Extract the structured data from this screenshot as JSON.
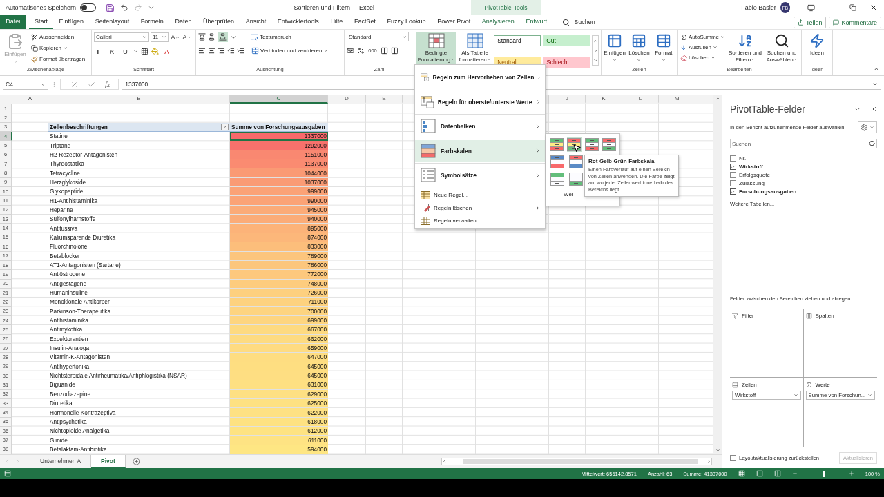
{
  "title_bar": {
    "autosave": {
      "label": "Automatisches Speichern",
      "on": false
    },
    "title": "Sortieren und Filtern  -  Excel",
    "context_tab": "PivotTable-Tools",
    "user": "Fabio Basler",
    "initials": "FB"
  },
  "tabs": [
    {
      "label": "Datei",
      "kind": "file",
      "selected": false
    },
    {
      "label": "Start",
      "kind": "normal",
      "selected": true
    },
    {
      "label": "Einfügen",
      "kind": "normal",
      "selected": false
    },
    {
      "label": "Seitenlayout",
      "kind": "normal",
      "selected": false
    },
    {
      "label": "Formeln",
      "kind": "normal",
      "selected": false
    },
    {
      "label": "Daten",
      "kind": "normal",
      "selected": false
    },
    {
      "label": "Überprüfen",
      "kind": "normal",
      "selected": false
    },
    {
      "label": "Ansicht",
      "kind": "normal",
      "selected": false
    },
    {
      "label": "Entwicklertools",
      "kind": "normal",
      "selected": false
    },
    {
      "label": "Hilfe",
      "kind": "normal",
      "selected": false
    },
    {
      "label": "FactSet",
      "kind": "normal",
      "selected": false
    },
    {
      "label": "Fuzzy Lookup",
      "kind": "normal",
      "selected": false
    },
    {
      "label": "Power Pivot",
      "kind": "normal",
      "selected": false
    },
    {
      "label": "Analysieren",
      "kind": "context",
      "selected": false
    },
    {
      "label": "Entwurf",
      "kind": "context",
      "selected": false
    }
  ],
  "tell_me": "Suchen",
  "share": "Teilen",
  "comments": "Kommentare",
  "clipboard": {
    "label": "Zwischenablage",
    "paste": "Einfügen",
    "cut": "Ausschneiden",
    "copy": "Kopieren",
    "format_painter": "Format übertragen"
  },
  "font": {
    "label": "Schriftart",
    "name": "Calibri",
    "size": "11",
    "grow": "A",
    "shrink": "A",
    "bold": "F",
    "italic": "K",
    "underline": "U",
    "color_letter": "A"
  },
  "alignment": {
    "label": "Ausrichtung",
    "wrap": "Textumbruch",
    "merge": "Verbinden und zentrieren"
  },
  "number": {
    "label": "Zahl",
    "format": "Standard",
    "thousands": "000"
  },
  "styles": {
    "conditional": {
      "label": "Bedingte Formatierung",
      "pressed": true
    },
    "as_table": "Als Tabelle formatieren",
    "gallery": [
      {
        "label": "Standard",
        "kind": "normal"
      },
      {
        "label": "Gut",
        "kind": "good"
      },
      {
        "label": "Neutral",
        "kind": "neutral"
      },
      {
        "label": "Schlecht",
        "kind": "bad"
      }
    ]
  },
  "cells": {
    "label": "Zellen",
    "buttons": [
      {
        "label": "Einfügen",
        "kind": "insert"
      },
      {
        "label": "Löschen",
        "kind": "delete"
      },
      {
        "label": "Format",
        "kind": "format"
      }
    ]
  },
  "editing": {
    "label": "Bearbeiten",
    "autosum": "AutoSumme",
    "fill": "Ausfüllen",
    "clear": "Löschen",
    "sort": "Sortieren und Filtern",
    "find": "Suchen und Auswählen"
  },
  "ideas": {
    "label": "Ideen",
    "button": "Ideen"
  },
  "formula_bar": {
    "name_box": "C4",
    "fx": "fx",
    "value": "1337000"
  },
  "columns_left": [
    {
      "label": "A",
      "selected": false
    },
    {
      "label": "B",
      "selected": false
    },
    {
      "label": "C",
      "selected": true
    },
    {
      "label": "D",
      "selected": false
    },
    {
      "label": "E",
      "selected": false
    }
  ],
  "columns_right": [
    {
      "label": "J",
      "selected": false
    },
    {
      "label": "K",
      "selected": false
    },
    {
      "label": "L",
      "selected": false
    },
    {
      "label": "M",
      "selected": false
    }
  ],
  "rows": [
    {
      "number": "1",
      "kind": "blank",
      "active": false
    },
    {
      "number": "2",
      "kind": "blank",
      "active": false
    },
    {
      "number": "3",
      "kind": "header",
      "label": "Zellenbeschriftungen",
      "value": "Summe von Forschungsausgaben",
      "active": false
    },
    {
      "number": "4",
      "kind": "data",
      "label": "Statine",
      "value": "1337000",
      "color": "#f8696b",
      "active": true
    },
    {
      "number": "5",
      "kind": "data",
      "label": "Triptane",
      "value": "1292000",
      "color": "#f8716c",
      "active": false
    },
    {
      "number": "6",
      "kind": "data",
      "label": "H2-Rezeptor-Antagonisten",
      "value": "1151000",
      "color": "#f98871",
      "active": false
    },
    {
      "number": "7",
      "kind": "data",
      "label": "Thyreostatika",
      "value": "1137000",
      "color": "#fa8b71",
      "active": false
    },
    {
      "number": "8",
      "kind": "data",
      "label": "Tetracycline",
      "value": "1044000",
      "color": "#fa9a74",
      "active": false
    },
    {
      "number": "9",
      "kind": "data",
      "label": "Herzglykoside",
      "value": "1037000",
      "color": "#fa9b75",
      "active": false
    },
    {
      "number": "10",
      "kind": "data",
      "label": "Glykopeptide",
      "value": "999000",
      "color": "#fba276",
      "active": false
    },
    {
      "number": "11",
      "kind": "data",
      "label": "H1-Antihistaminika",
      "value": "990000",
      "color": "#fba376",
      "active": false
    },
    {
      "number": "12",
      "kind": "data",
      "label": "Heparine",
      "value": "945000",
      "color": "#fbab78",
      "active": false
    },
    {
      "number": "13",
      "kind": "data",
      "label": "Sulfonylharnstoffe",
      "value": "940000",
      "color": "#fbac78",
      "active": false
    },
    {
      "number": "14",
      "kind": "data",
      "label": "Antitussiva",
      "value": "895000",
      "color": "#fcb379",
      "active": false
    },
    {
      "number": "15",
      "kind": "data",
      "label": "Kaliumsparende Diuretika",
      "value": "874000",
      "color": "#fcb77a",
      "active": false
    },
    {
      "number": "16",
      "kind": "data",
      "label": "Fluorchinolone",
      "value": "833000",
      "color": "#fcbe7b",
      "active": false
    },
    {
      "number": "17",
      "kind": "data",
      "label": "Betablocker",
      "value": "789000",
      "color": "#fcc57d",
      "active": false
    },
    {
      "number": "18",
      "kind": "data",
      "label": "AT1-Antagonisten (Sartane)",
      "value": "786000",
      "color": "#fcc67d",
      "active": false
    },
    {
      "number": "19",
      "kind": "data",
      "label": "Antiöstrogene",
      "value": "772000",
      "color": "#fdc87d",
      "active": false
    },
    {
      "number": "20",
      "kind": "data",
      "label": "Antigestagene",
      "value": "748000",
      "color": "#fdcc7e",
      "active": false
    },
    {
      "number": "21",
      "kind": "data",
      "label": "Humaninsuline",
      "value": "726000",
      "color": "#fdd07f",
      "active": false
    },
    {
      "number": "22",
      "kind": "data",
      "label": "Monoklonale Antikörper",
      "value": "711000",
      "color": "#fdd27f",
      "active": false
    },
    {
      "number": "23",
      "kind": "data",
      "label": "Parkinson-Therapeutika",
      "value": "700000",
      "color": "#fdd480",
      "active": false
    },
    {
      "number": "24",
      "kind": "data",
      "label": "Antihistaminika",
      "value": "699000",
      "color": "#fdd580",
      "active": false
    },
    {
      "number": "25",
      "kind": "data",
      "label": "Antimykotika",
      "value": "667000",
      "color": "#fdda81",
      "active": false
    },
    {
      "number": "26",
      "kind": "data",
      "label": "Expektorantien",
      "value": "662000",
      "color": "#fddb81",
      "active": false
    },
    {
      "number": "27",
      "kind": "data",
      "label": "Insulin-Analoga",
      "value": "659000",
      "color": "#fedb81",
      "active": false
    },
    {
      "number": "28",
      "kind": "data",
      "label": "Vitamin-K-Antagonisten",
      "value": "647000",
      "color": "#fedd81",
      "active": false
    },
    {
      "number": "29",
      "kind": "data",
      "label": "Antihypertonika",
      "value": "645000",
      "color": "#fede81",
      "active": false
    },
    {
      "number": "30",
      "kind": "data",
      "label": "Nichtsteroidale Antirheumatika/Antiphlogistika (NSAR)",
      "value": "645000",
      "color": "#fede82",
      "active": false
    },
    {
      "number": "31",
      "kind": "data",
      "label": "Biguanide",
      "value": "631000",
      "color": "#fee082",
      "active": false
    },
    {
      "number": "32",
      "kind": "data",
      "label": "Benzodiazepine",
      "value": "629000",
      "color": "#fee083",
      "active": false
    },
    {
      "number": "33",
      "kind": "data",
      "label": "Diuretika",
      "value": "625000",
      "color": "#fee182",
      "active": false
    },
    {
      "number": "34",
      "kind": "data",
      "label": "Hormonelle Kontrazeptiva",
      "value": "622000",
      "color": "#fee183",
      "active": false
    },
    {
      "number": "35",
      "kind": "data",
      "label": "Antipsychotika",
      "value": "618000",
      "color": "#fee282",
      "active": false
    },
    {
      "number": "36",
      "kind": "data",
      "label": "Nichtopioide Analgetika",
      "value": "612000",
      "color": "#fee382",
      "active": false
    },
    {
      "number": "37",
      "kind": "data",
      "label": "Glinide",
      "value": "611000",
      "color": "#fee383",
      "active": false
    },
    {
      "number": "38",
      "kind": "data",
      "label": "Betalaktam-Antibiotika",
      "value": "594000",
      "color": "#fee683",
      "active": false
    }
  ],
  "sheet_tabs": [
    {
      "label": "Unternehmen A",
      "selected": false
    },
    {
      "label": "Pivot",
      "selected": true
    }
  ],
  "pivot_panel": {
    "title": "PivotTable-Felder",
    "choose_label": "In den Bericht aufzunehmende Felder auswählen:",
    "search": {
      "placeholder": "Suchen"
    },
    "fields": [
      {
        "label": "Nr.",
        "checked": false
      },
      {
        "label": "Wirkstoff",
        "checked": true
      },
      {
        "label": "Erfolgsquote",
        "checked": false
      },
      {
        "label": "Zulassung",
        "checked": false
      },
      {
        "label": "Forschungsausgaben",
        "checked": true
      }
    ],
    "more_tables": "Weitere Tabellen...",
    "drag_label": "Felder zwischen den Bereichen ziehen und ablegen:",
    "areas": [
      {
        "kind": "filter",
        "label": "Filter"
      },
      {
        "kind": "columns",
        "label": "Spalten"
      },
      {
        "kind": "rows",
        "label": "Zeilen",
        "items": [
          "Wirkstoff"
        ]
      },
      {
        "kind": "values",
        "label": "Werte",
        "items": [
          "Summe von Forschun..."
        ]
      }
    ],
    "defer": {
      "label": "Layoutaktualisierung zurückstellen",
      "checked": false
    },
    "update": {
      "label": "Aktualisieren",
      "disabled": true
    }
  },
  "status_bar": {
    "average": "Mittelwert: 656142,8571",
    "count": "Anzahl: 63",
    "sum": "Summe: 41337000",
    "zoom_slider": {
      "level": 0.5
    },
    "zoom": "100 %"
  },
  "menu": {
    "items": [
      {
        "label": "Regeln zum Hervorheben von Zellen",
        "kind": "highlight",
        "submenu": true,
        "selected": false
      },
      {
        "label": "Regeln für oberste/unterste Werte",
        "kind": "topbottom",
        "submenu": true,
        "selected": false
      },
      {
        "label": "Datenbalken",
        "kind": "databar",
        "submenu": true,
        "selected": false
      },
      {
        "label": "Farbskalen",
        "kind": "colorscale",
        "submenu": true,
        "selected": true
      },
      {
        "label": "Symbolsätze",
        "kind": "iconset",
        "submenu": true,
        "selected": false
      },
      {
        "label": "Neue Regel...",
        "kind": "new",
        "submenu": false,
        "selected": false
      },
      {
        "label": "Regeln löschen",
        "kind": "clear",
        "submenu": true,
        "selected": false
      },
      {
        "label": "Regeln verwalten...",
        "kind": "manage",
        "submenu": false,
        "selected": false
      }
    ]
  },
  "color_scales": {
    "rows": [
      [
        {
          "selected": false
        },
        {
          "selected": true
        },
        {
          "selected": false
        },
        {
          "selected": false
        }
      ],
      [
        {
          "selected": false
        },
        {
          "selected": false
        }
      ],
      [
        {
          "selected": false
        },
        {
          "selected": false
        }
      ]
    ],
    "more": "Wei"
  },
  "tooltip": {
    "title": "Rot-Gelb-Grün-Farbskala",
    "text": "Einen Farbverlauf auf einen Bereich von Zellen anwenden. Die Farbe zeigt an, wo jeder Zellenwert innerhalb des Bereichs liegt."
  }
}
